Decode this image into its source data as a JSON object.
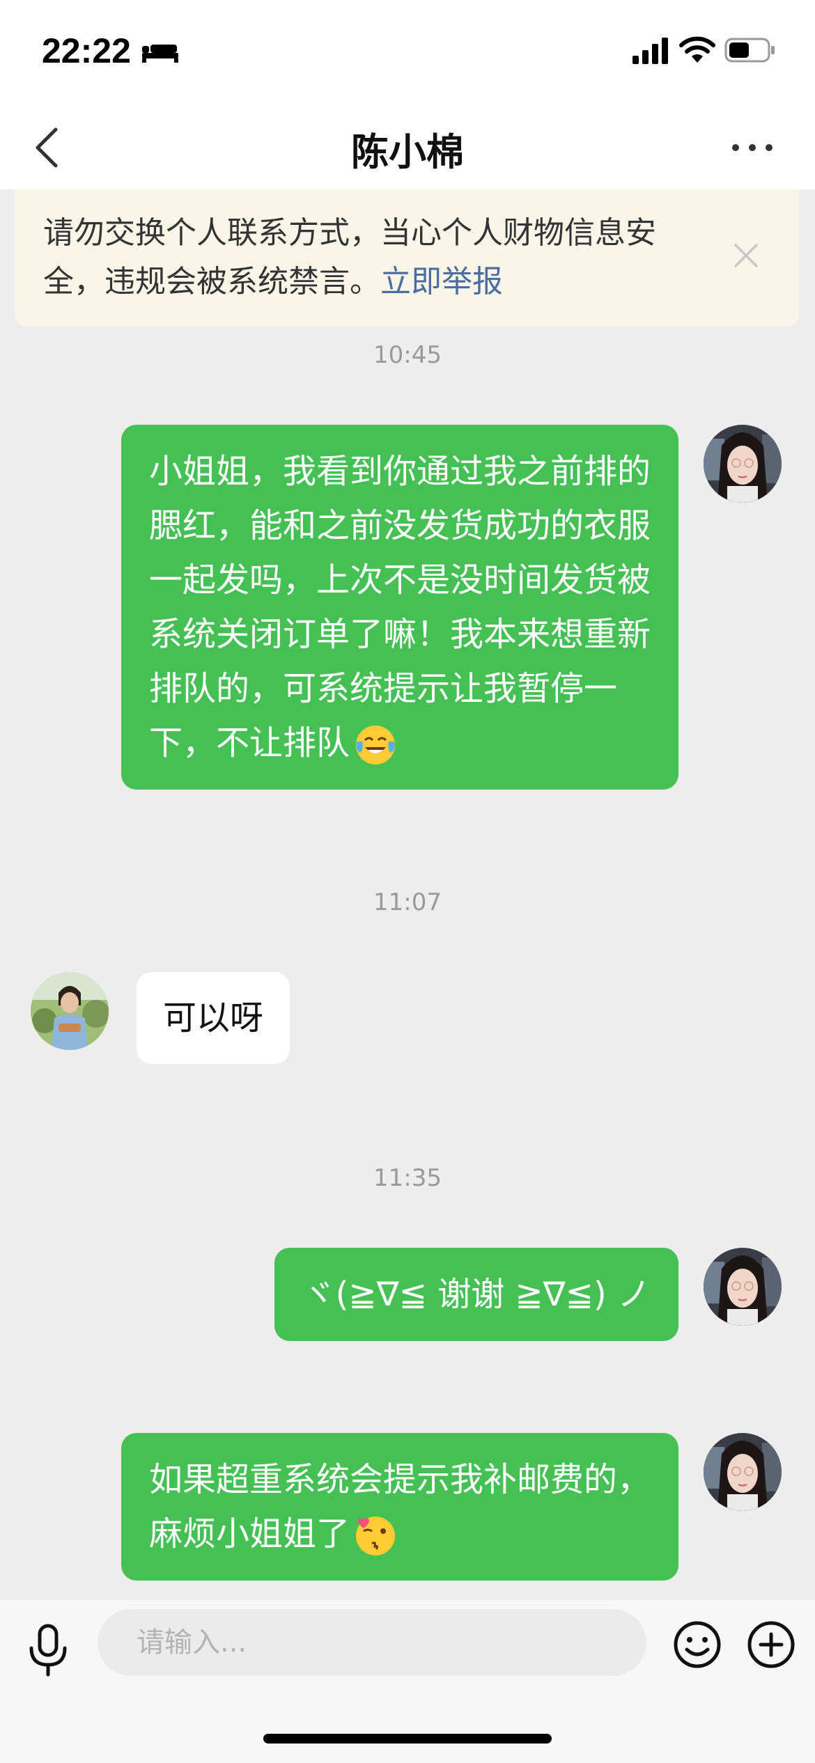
{
  "status_bar": {
    "time": "22:22",
    "icons": [
      "bed-icon",
      "cellular-signal-icon",
      "wifi-icon",
      "battery-icon"
    ]
  },
  "nav": {
    "title": "陈小棉",
    "back_icon": "chevron-left-icon",
    "more_icon": "more-dots-icon"
  },
  "warning": {
    "text": "请勿交换个人联系方式，当心个人财物信息安全，违规会被系统禁言。",
    "link": "立即举报"
  },
  "messages": [
    {
      "time": "10:45",
      "sender": "me",
      "text": "小姐姐，我看到你通过我之前排的腮红，能和之前没发货成功的衣服一起发吗，上次不是没时间发货被系统关闭订单了嘛！我本来想重新排队的，可系统提示让我暂停一下，不让排队",
      "emoji": "laughing-tears-emoji"
    },
    {
      "time": "11:07",
      "sender": "other",
      "text": "可以呀"
    },
    {
      "time": "11:35",
      "sender": "me",
      "text": "ヾ(≧∇≦ 谢谢 ≧∇≦) ノ"
    },
    {
      "sender": "me",
      "text": "如果超重系统会提示我补邮费的，麻烦小姐姐了",
      "emoji": "wink-kiss-emoji"
    }
  ],
  "input": {
    "placeholder": "请输入..."
  },
  "colors": {
    "bubble_me": "#45c055",
    "bubble_other": "#ffffff",
    "background": "#ededed",
    "link": "#4a6ca3",
    "warning_bg": "#f9f6e8"
  }
}
